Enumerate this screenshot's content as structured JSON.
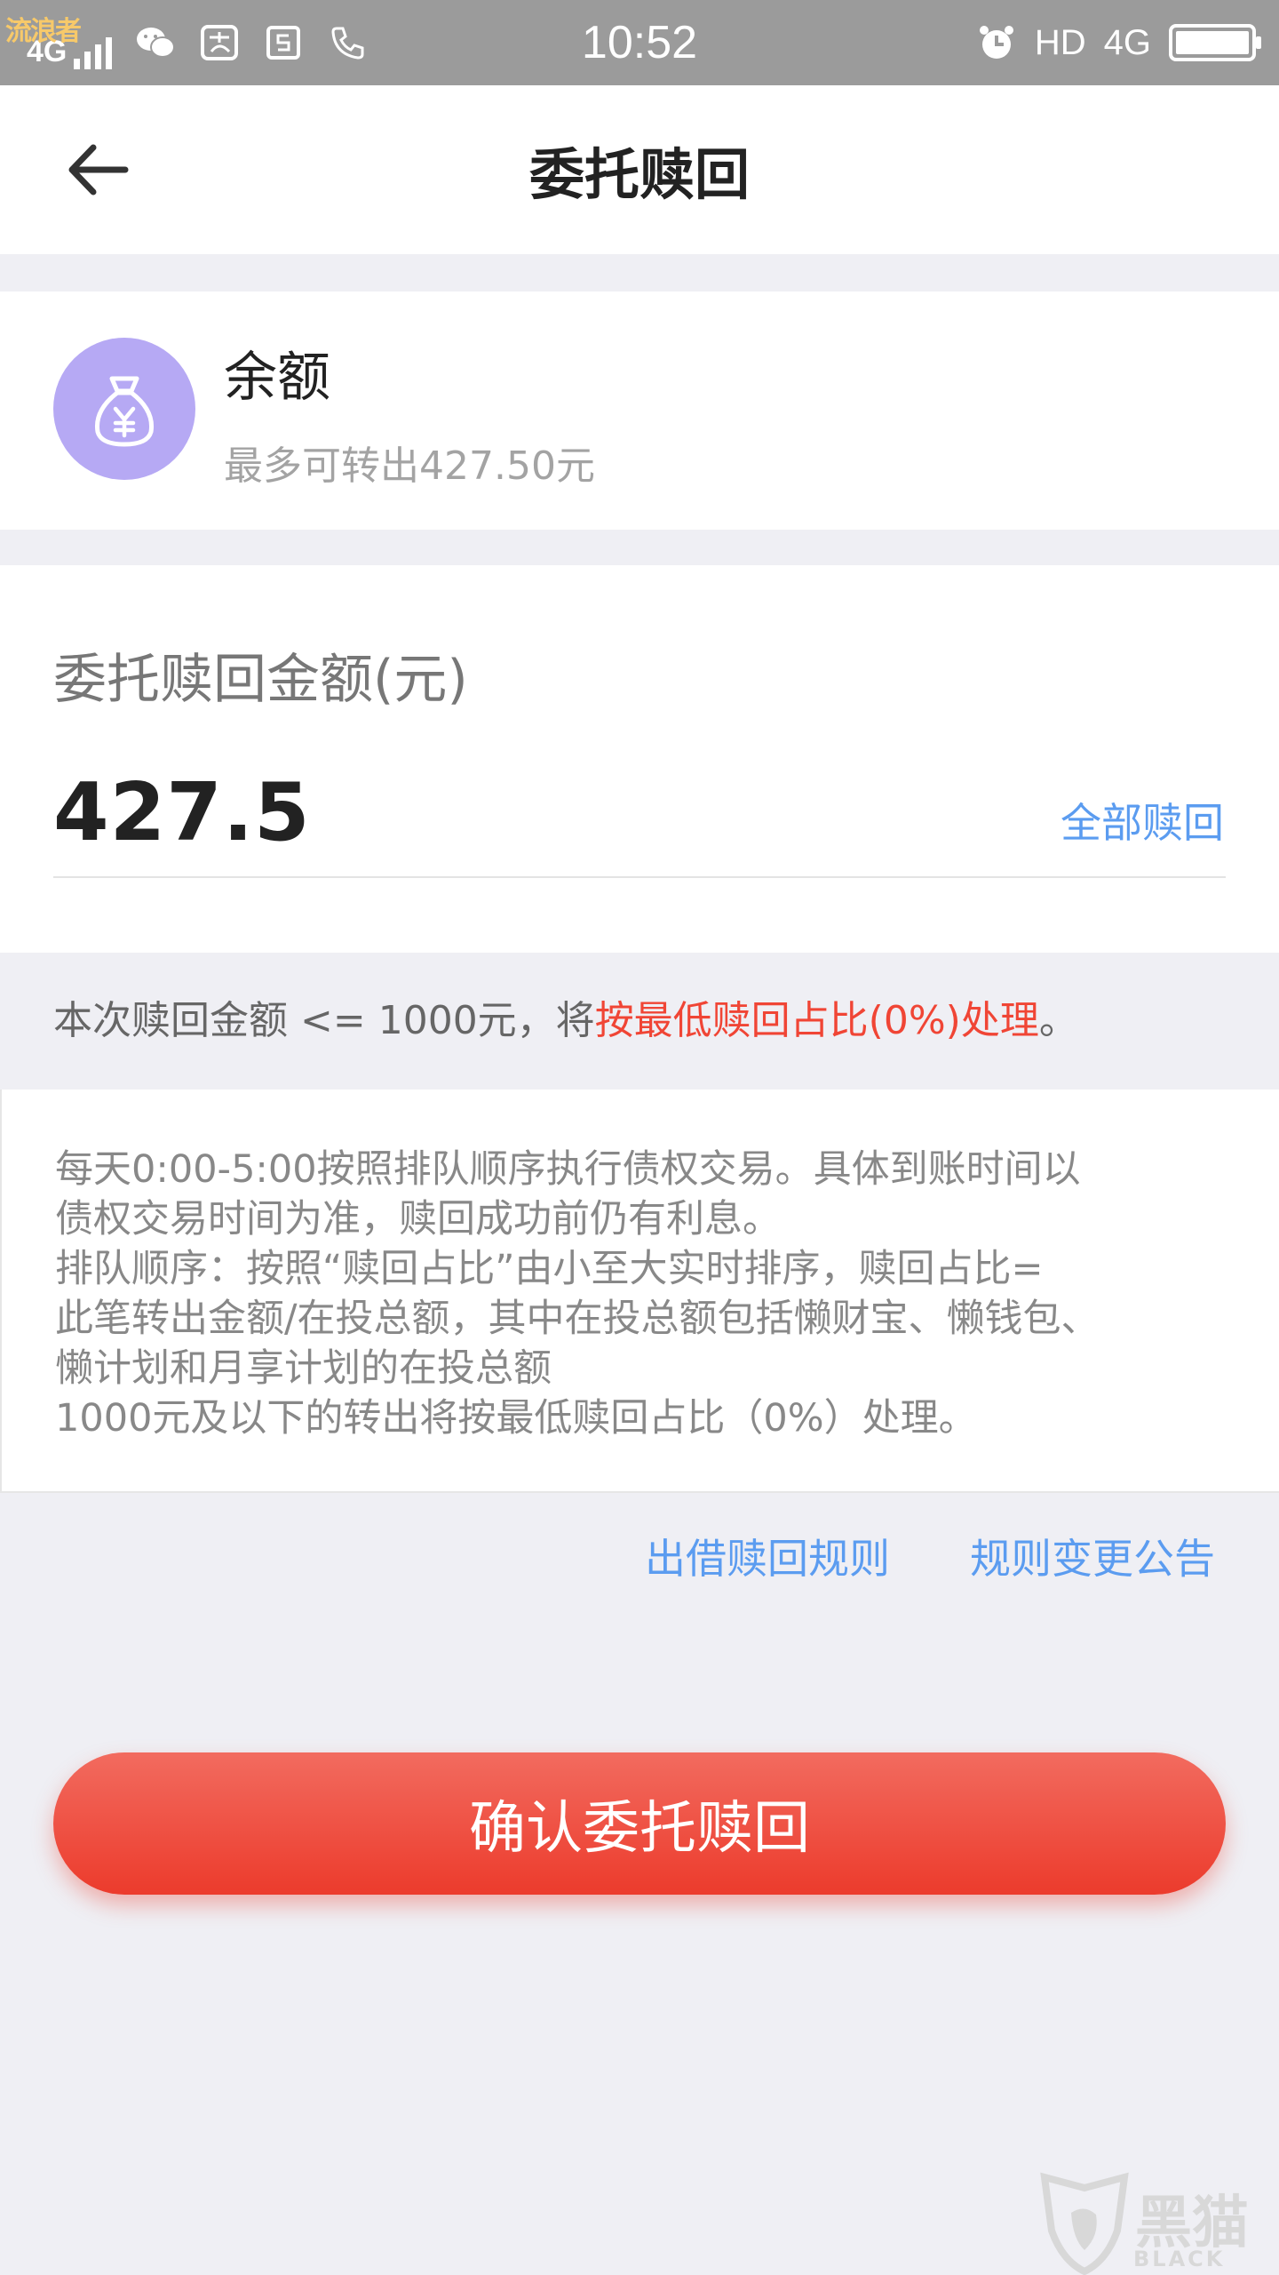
{
  "status_bar": {
    "network_label": "4G",
    "watermark": "流浪者",
    "time": "10:52",
    "right_hd": "HD",
    "right_4g": "4G",
    "battery_level": 0.9
  },
  "header": {
    "title": "委托赎回"
  },
  "balance": {
    "title": "余额",
    "subtitle": "最多可转出427.50元",
    "icon_color": "#b6a9f4"
  },
  "amount": {
    "label": "委托赎回金额(元)",
    "value": "427.5",
    "redeem_all_label": "全部赎回"
  },
  "notice": {
    "prefix": "本次赎回金额 <= 1000元，将",
    "highlight": "按最低赎回占比(0%)处理",
    "suffix": "。"
  },
  "rules": {
    "lines": [
      "每天0:00-5:00按照排队顺序执行债权交易。具体到账时间以",
      "债权交易时间为准，赎回成功前仍有利息。",
      "排队顺序：按照“赎回占比”由小至大实时排序，赎回占比=",
      "此笔转出金额/在投总额，其中在投总额包括懒财宝、懒钱包、",
      "懒计划和月享计划的在投总额",
      "1000元及以下的转出将按最低赎回占比（0%）处理。"
    ]
  },
  "links": {
    "rules": "出借赎回规则",
    "announcement": "规则变更公告"
  },
  "confirm_button": {
    "label": "确认委托赎回",
    "color": "#ec3b2c"
  },
  "watermark": {
    "text": "黑猫",
    "sub": "BLACK CAT"
  },
  "colors": {
    "accent_blue": "#5b9cf0",
    "accent_red": "#f04535",
    "background": "#efeff4"
  }
}
